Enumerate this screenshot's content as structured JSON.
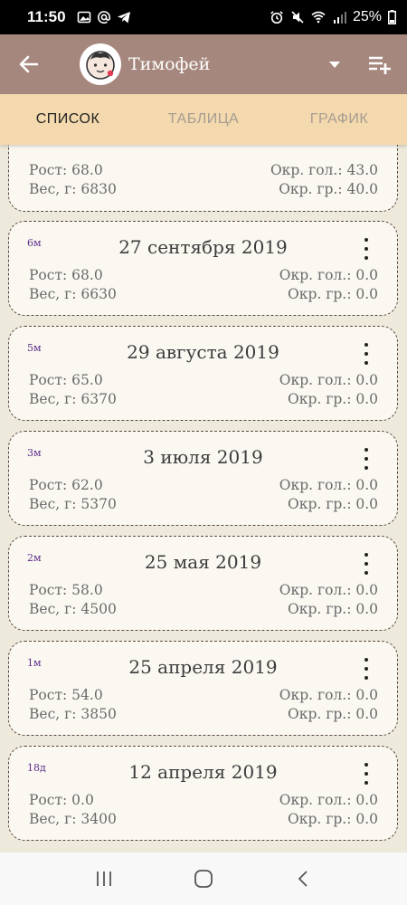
{
  "status": {
    "time": "11:50",
    "battery": "25%"
  },
  "appbar": {
    "child_name": "Тимофей"
  },
  "tabs": [
    {
      "label": "СПИСОК",
      "active": true
    },
    {
      "label": "ТАБЛИЦА",
      "active": false
    },
    {
      "label": "ГРАФИК",
      "active": false
    }
  ],
  "entries": [
    {
      "age": "",
      "date": "",
      "height": "Рост: 68.0",
      "weight": "Вес, г: 6830",
      "head": "Окр. гол.: 43.0",
      "chest": "Окр. гр.: 40.0",
      "partial": true
    },
    {
      "age": "6м",
      "date": "27 сентября 2019",
      "height": "Рост: 68.0",
      "weight": "Вес, г: 6630",
      "head": "Окр. гол.: 0.0",
      "chest": "Окр. гр.: 0.0"
    },
    {
      "age": "5м",
      "date": "29 августа 2019",
      "height": "Рост: 65.0",
      "weight": "Вес, г: 6370",
      "head": "Окр. гол.: 0.0",
      "chest": "Окр. гр.: 0.0"
    },
    {
      "age": "3м",
      "date": "3 июля 2019",
      "height": "Рост: 62.0",
      "weight": "Вес, г: 5370",
      "head": "Окр. гол.: 0.0",
      "chest": "Окр. гр.: 0.0"
    },
    {
      "age": "2м",
      "date": "25 мая 2019",
      "height": "Рост: 58.0",
      "weight": "Вес, г: 4500",
      "head": "Окр. гол.: 0.0",
      "chest": "Окр. гр.: 0.0"
    },
    {
      "age": "1м",
      "date": "25 апреля 2019",
      "height": "Рост: 54.0",
      "weight": "Вес, г: 3850",
      "head": "Окр. гол.: 0.0",
      "chest": "Окр. гр.: 0.0"
    },
    {
      "age": "18д",
      "date": "12 апреля 2019",
      "height": "Рост: 0.0",
      "weight": "Вес, г: 3400",
      "head": "Окр. гол.: 0.0",
      "chest": "Окр. гр.: 0.0"
    }
  ],
  "icons": {
    "back": "arrow-left-icon",
    "avatar": "baby-face-icon",
    "dropdown": "dropdown-triangle-icon",
    "add": "playlist-add-icon",
    "entry_menu": "more-vertical-icon"
  }
}
